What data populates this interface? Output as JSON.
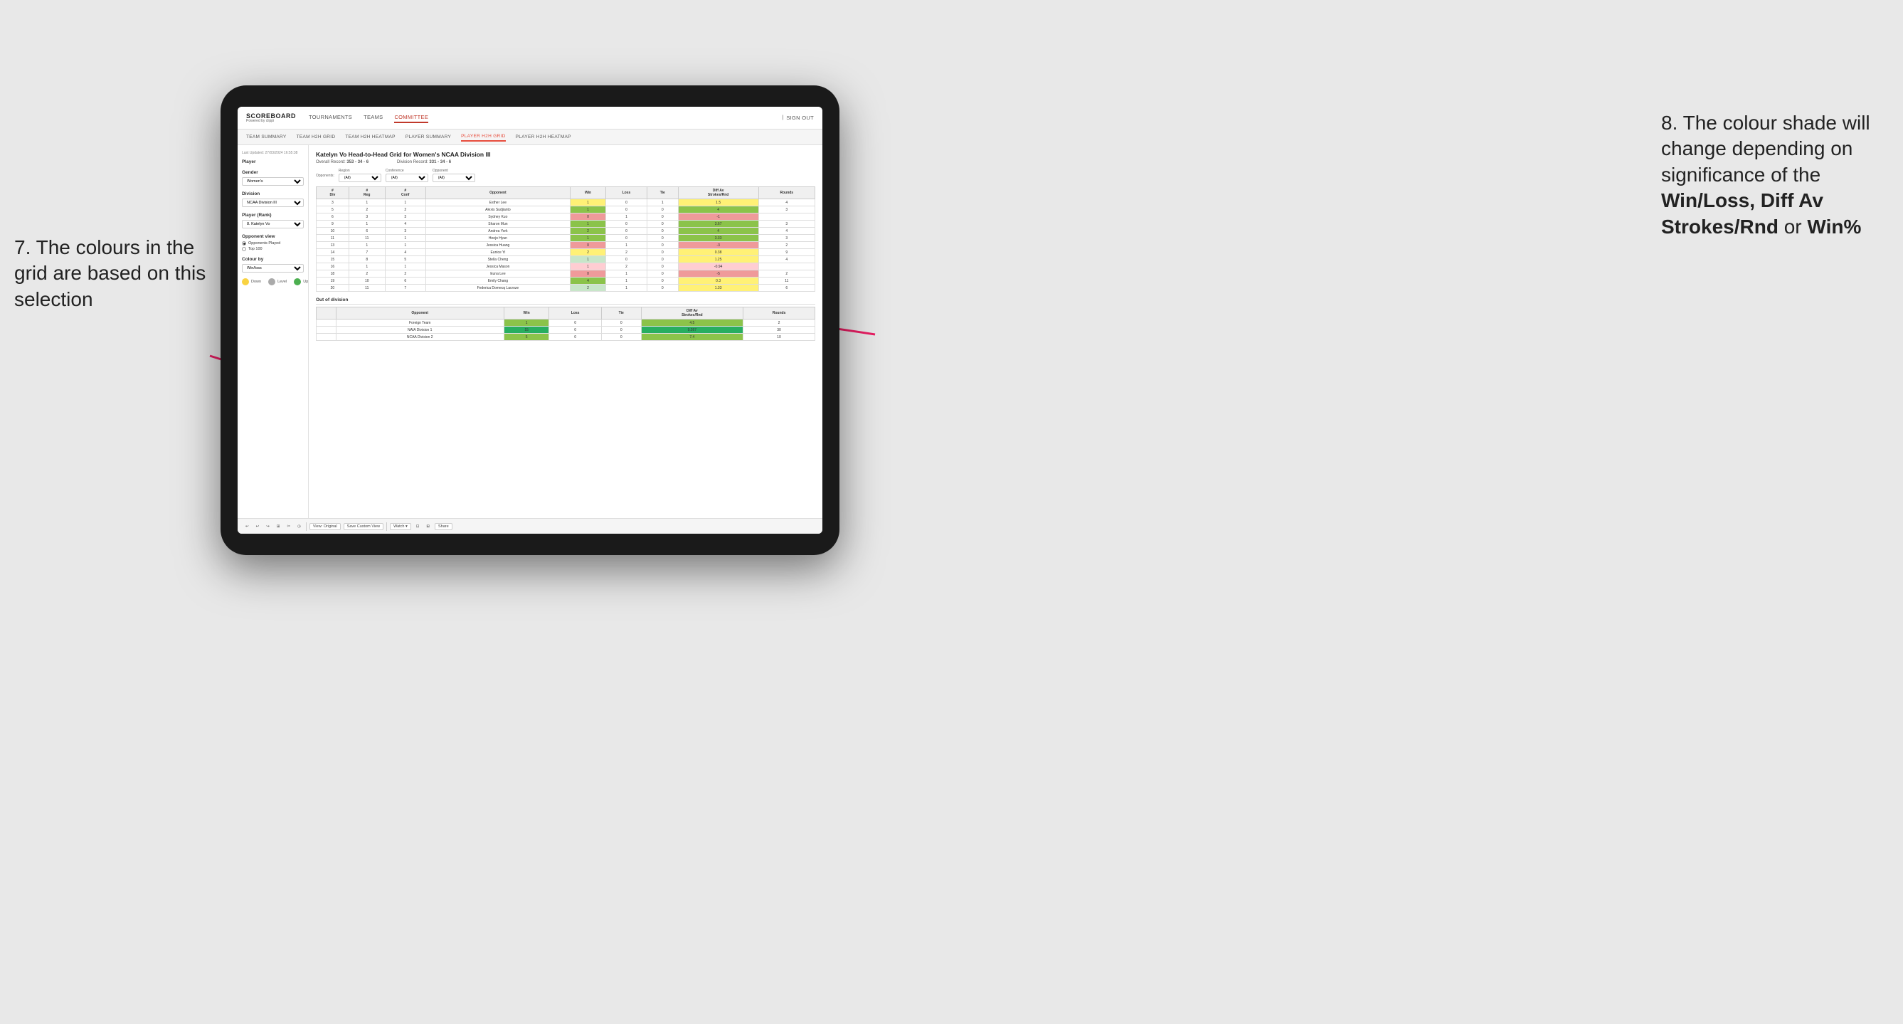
{
  "app": {
    "logo": "SCOREBOARD",
    "logo_sub": "Powered by clippi",
    "nav": [
      "TOURNAMENTS",
      "TEAMS",
      "COMMITTEE"
    ],
    "nav_active": "COMMITTEE",
    "nav_right": [
      "Sign out"
    ],
    "sub_nav": [
      "TEAM SUMMARY",
      "TEAM H2H GRID",
      "TEAM H2H HEATMAP",
      "PLAYER SUMMARY",
      "PLAYER H2H GRID",
      "PLAYER H2H HEATMAP"
    ],
    "sub_nav_active": "PLAYER H2H GRID"
  },
  "sidebar": {
    "last_updated": "Last Updated: 27/03/2024 16:55:38",
    "player_label": "Player",
    "gender_label": "Gender",
    "gender_value": "Women's",
    "division_label": "Division",
    "division_value": "NCAA Division III",
    "player_rank_label": "Player (Rank)",
    "player_rank_value": "8. Katelyn Vo",
    "opponent_view_label": "Opponent view",
    "opponent_view_options": [
      "Opponents Played",
      "Top 100"
    ],
    "opponent_view_selected": "Opponents Played",
    "colour_by_label": "Colour by",
    "colour_by_value": "Win/loss",
    "legend": [
      {
        "label": "Down",
        "color": "#f9d342"
      },
      {
        "label": "Level",
        "color": "#aaa"
      },
      {
        "label": "Up",
        "color": "#4caf50"
      }
    ]
  },
  "grid": {
    "title": "Katelyn Vo Head-to-Head Grid for Women's NCAA Division III",
    "overall_record_label": "Overall Record:",
    "overall_record": "353 - 34 - 6",
    "division_record_label": "Division Record:",
    "division_record": "331 - 34 - 6",
    "filters": {
      "region_label": "Region",
      "region_value": "(All)",
      "conference_label": "Conference",
      "conference_value": "(All)",
      "opponent_label": "Opponent",
      "opponent_value": "(All)"
    },
    "opponents_label": "Opponents:",
    "col_headers": [
      "# Div",
      "# Reg",
      "# Conf",
      "Opponent",
      "Win",
      "Loss",
      "Tie",
      "Diff Av Strokes/Rnd",
      "Rounds"
    ],
    "rows": [
      {
        "div": "3",
        "reg": "1",
        "conf": "1",
        "opponent": "Esther Lee",
        "win": 1,
        "loss": 0,
        "tie": 1,
        "diff": 1.5,
        "rounds": 4,
        "win_color": "yellow",
        "diff_color": "yellow"
      },
      {
        "div": "5",
        "reg": "2",
        "conf": "2",
        "opponent": "Alexis Sudjianto",
        "win": 1,
        "loss": 0,
        "tie": 0,
        "diff": 4.0,
        "rounds": 3,
        "win_color": "green",
        "diff_color": "green"
      },
      {
        "div": "6",
        "reg": "3",
        "conf": "3",
        "opponent": "Sydney Kuo",
        "win": 0,
        "loss": 1,
        "tie": 0,
        "diff": -1.0,
        "rounds": "",
        "win_color": "red",
        "diff_color": "red"
      },
      {
        "div": "9",
        "reg": "1",
        "conf": "4",
        "opponent": "Sharon Mun",
        "win": 1,
        "loss": 0,
        "tie": 0,
        "diff": 3.67,
        "rounds": 3,
        "win_color": "green",
        "diff_color": "green"
      },
      {
        "div": "10",
        "reg": "6",
        "conf": "3",
        "opponent": "Andrea York",
        "win": 2,
        "loss": 0,
        "tie": 0,
        "diff": 4.0,
        "rounds": 4,
        "win_color": "green",
        "diff_color": "green"
      },
      {
        "div": "11",
        "reg": "11",
        "conf": "1",
        "opponent": "Heejo Hyun",
        "win": 1,
        "loss": 0,
        "tie": 0,
        "diff": 3.33,
        "rounds": 3,
        "win_color": "green",
        "diff_color": "green"
      },
      {
        "div": "13",
        "reg": "1",
        "conf": "1",
        "opponent": "Jessica Huang",
        "win": 0,
        "loss": 1,
        "tie": 0,
        "diff": -3.0,
        "rounds": 2,
        "win_color": "red",
        "diff_color": "red"
      },
      {
        "div": "14",
        "reg": "7",
        "conf": "4",
        "opponent": "Eunice Yi",
        "win": 2,
        "loss": 2,
        "tie": 0,
        "diff": 0.38,
        "rounds": 9,
        "win_color": "yellow",
        "diff_color": "yellow"
      },
      {
        "div": "15",
        "reg": "8",
        "conf": "5",
        "opponent": "Stella Cheng",
        "win": 1,
        "loss": 0,
        "tie": 0,
        "diff": 1.25,
        "rounds": 4,
        "win_color": "light-green",
        "diff_color": "yellow"
      },
      {
        "div": "16",
        "reg": "1",
        "conf": "1",
        "opponent": "Jessica Mason",
        "win": 1,
        "loss": 2,
        "tie": 0,
        "diff": -0.94,
        "rounds": "",
        "win_color": "light-red",
        "diff_color": "light-red"
      },
      {
        "div": "18",
        "reg": "2",
        "conf": "2",
        "opponent": "Euna Lee",
        "win": 0,
        "loss": 1,
        "tie": 0,
        "diff": -5.0,
        "rounds": 2,
        "win_color": "red",
        "diff_color": "red"
      },
      {
        "div": "19",
        "reg": "10",
        "conf": "6",
        "opponent": "Emily Chang",
        "win": 4,
        "loss": 1,
        "tie": 0,
        "diff": 0.3,
        "rounds": 11,
        "win_color": "green",
        "diff_color": "yellow"
      },
      {
        "div": "20",
        "reg": "11",
        "conf": "7",
        "opponent": "Federica Domecq Lacroze",
        "win": 2,
        "loss": 1,
        "tie": 0,
        "diff": 1.33,
        "rounds": 6,
        "win_color": "light-green",
        "diff_color": "yellow"
      }
    ],
    "out_of_division_label": "Out of division",
    "out_of_division_rows": [
      {
        "opponent": "Foreign Team",
        "win": 1,
        "loss": 0,
        "tie": 0,
        "diff": 4.5,
        "rounds": 2,
        "win_color": "green",
        "diff_color": "green"
      },
      {
        "opponent": "NAIA Division 1",
        "win": 15,
        "loss": 0,
        "tie": 0,
        "diff": 9.267,
        "rounds": 30,
        "win_color": "dark-green",
        "diff_color": "dark-green"
      },
      {
        "opponent": "NCAA Division 2",
        "win": 5,
        "loss": 0,
        "tie": 0,
        "diff": 7.4,
        "rounds": 10,
        "win_color": "green",
        "diff_color": "green"
      }
    ]
  },
  "toolbar": {
    "buttons": [
      "↩",
      "↩",
      "↪",
      "⊞",
      "✂",
      "◷",
      "|",
      "View: Original",
      "Save Custom View",
      "Watch ▾",
      "⊡",
      "⊞",
      "Share"
    ]
  },
  "annotations": {
    "left_title": "7. The colours in the grid are based on this selection",
    "right_title": "8. The colour shade will change depending on significance of the",
    "right_bold": "Win/Loss, Diff Av Strokes/Rnd",
    "right_or": "or",
    "right_bold2": "Win%"
  }
}
